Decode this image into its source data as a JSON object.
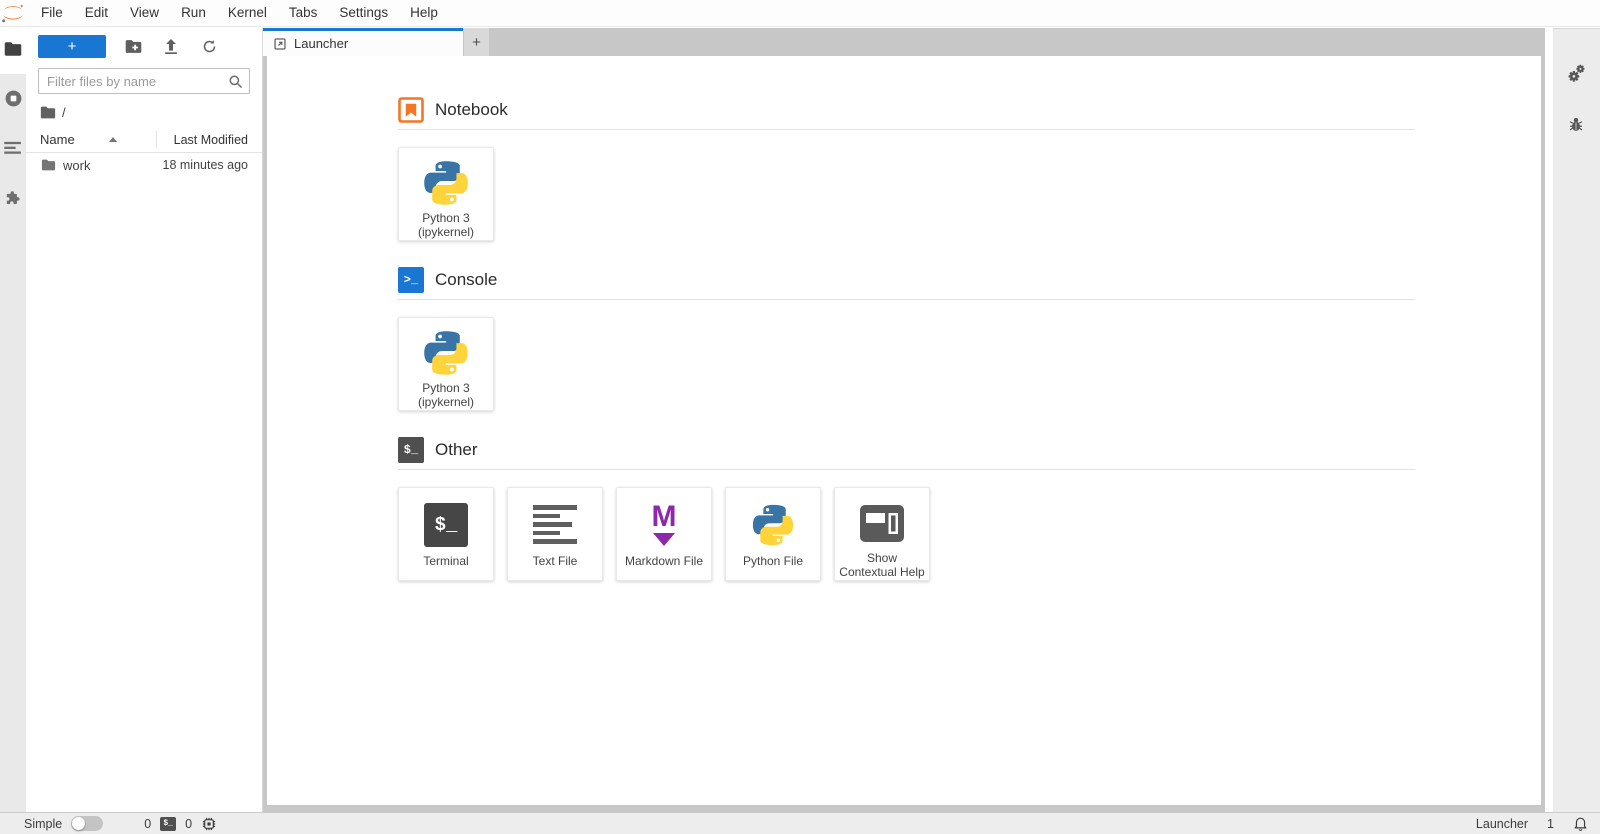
{
  "colors": {
    "accent": "#1976d2",
    "jupyter_orange": "#f37626",
    "markdown_purple": "#8d28ad",
    "python_blue": "#3874a5",
    "python_yellow": "#ffd43b"
  },
  "menu_bar": {
    "items": [
      "File",
      "Edit",
      "View",
      "Run",
      "Kernel",
      "Tabs",
      "Settings",
      "Help"
    ]
  },
  "left_sidebar": {
    "items": [
      {
        "icon": "folder-icon",
        "active": true
      },
      {
        "icon": "running-kernels-icon",
        "active": false
      },
      {
        "icon": "table-of-contents-icon",
        "active": false
      },
      {
        "icon": "extensions-icon",
        "active": false
      }
    ]
  },
  "file_browser": {
    "new_launcher_label": "+",
    "filter_placeholder": "Filter files by name",
    "breadcrumb_root": "/",
    "columns": {
      "name": "Name",
      "last_modified": "Last Modified"
    },
    "rows": [
      {
        "name": "work",
        "last_modified": "18 minutes ago",
        "type": "folder"
      }
    ]
  },
  "dock": {
    "tabs": [
      {
        "label": "Launcher",
        "active": true
      }
    ],
    "add_tab_label": "+"
  },
  "launcher": {
    "sections": [
      {
        "title": "Notebook",
        "icon": "notebook-icon",
        "cards": [
          {
            "icon": "python-logo-icon",
            "label_lines": [
              "Python 3",
              "(ipykernel)"
            ]
          }
        ]
      },
      {
        "title": "Console",
        "icon": "console-icon",
        "cards": [
          {
            "icon": "python-logo-icon",
            "label_lines": [
              "Python 3",
              "(ipykernel)"
            ]
          }
        ]
      },
      {
        "title": "Other",
        "icon": "terminal-icon",
        "cards": [
          {
            "icon": "terminal-icon",
            "label_lines": [
              "Terminal"
            ]
          },
          {
            "icon": "text-file-icon",
            "label_lines": [
              "Text File"
            ]
          },
          {
            "icon": "markdown-file-icon",
            "label_lines": [
              "Markdown File"
            ]
          },
          {
            "icon": "python-logo-icon",
            "label_lines": [
              "Python File"
            ]
          },
          {
            "icon": "contextual-help-icon",
            "label_lines": [
              "Show",
              "Contextual Help"
            ]
          }
        ]
      }
    ]
  },
  "icon_glyphs": {
    "console_prompt": ">_",
    "terminal_prompt": "$_",
    "markdown_letter": "M"
  },
  "right_sidebar": {
    "items": [
      {
        "icon": "property-inspector-gears-icon"
      },
      {
        "icon": "debugger-bug-icon"
      }
    ]
  },
  "status_bar": {
    "mode_label": "Simple",
    "terminals_count": "0",
    "kernels_count": "0",
    "context_label": "Launcher",
    "notifications_count": "1"
  }
}
